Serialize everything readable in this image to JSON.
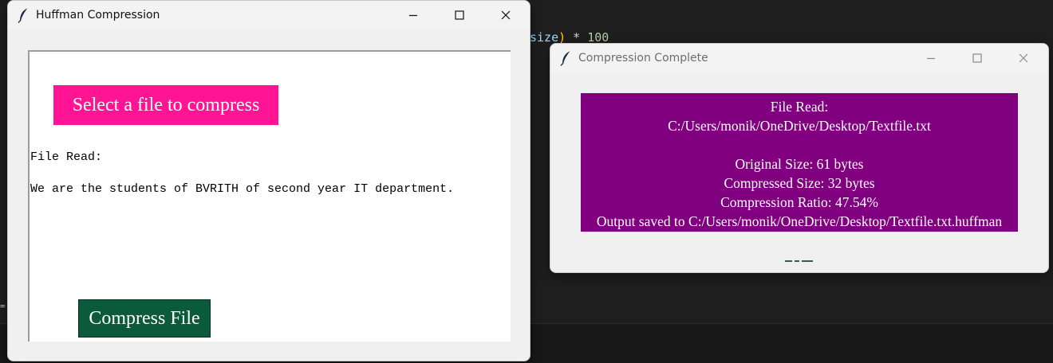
{
  "background_editor": {
    "code_fragment": {
      "var": "size",
      "paren": ")",
      "operator": " * ",
      "number": "100"
    }
  },
  "main_window": {
    "title": "Huffman Compression",
    "icon": "feather-icon",
    "controls": [
      "minimize-icon",
      "maximize-icon",
      "close-icon"
    ],
    "select_button_label": "Select a file to compress",
    "file_read_label": "File Read:",
    "file_content": "We are the students of BVRITH of second year IT department.",
    "compress_button_label": "Compress File",
    "colors": {
      "select_button_bg": "#ff1493",
      "compress_button_bg": "#0b5a3b"
    }
  },
  "dialog": {
    "title": "Compression Complete",
    "icon": "feather-icon",
    "controls": [
      "minimize-icon",
      "maximize-icon",
      "close-icon"
    ],
    "lines": {
      "file_read": "File Read:",
      "file_path": "C:/Users/monik/OneDrive/Desktop/Textfile.txt",
      "original_size": "Original Size: 61 bytes",
      "compressed_size": "Compressed Size: 32 bytes",
      "ratio": "Compression Ratio: 47.54%",
      "output": "Output saved to C:/Users/monik/OneDrive/Desktop/Textfile.txt.huffman"
    },
    "colors": {
      "result_bg": "#800080"
    }
  }
}
